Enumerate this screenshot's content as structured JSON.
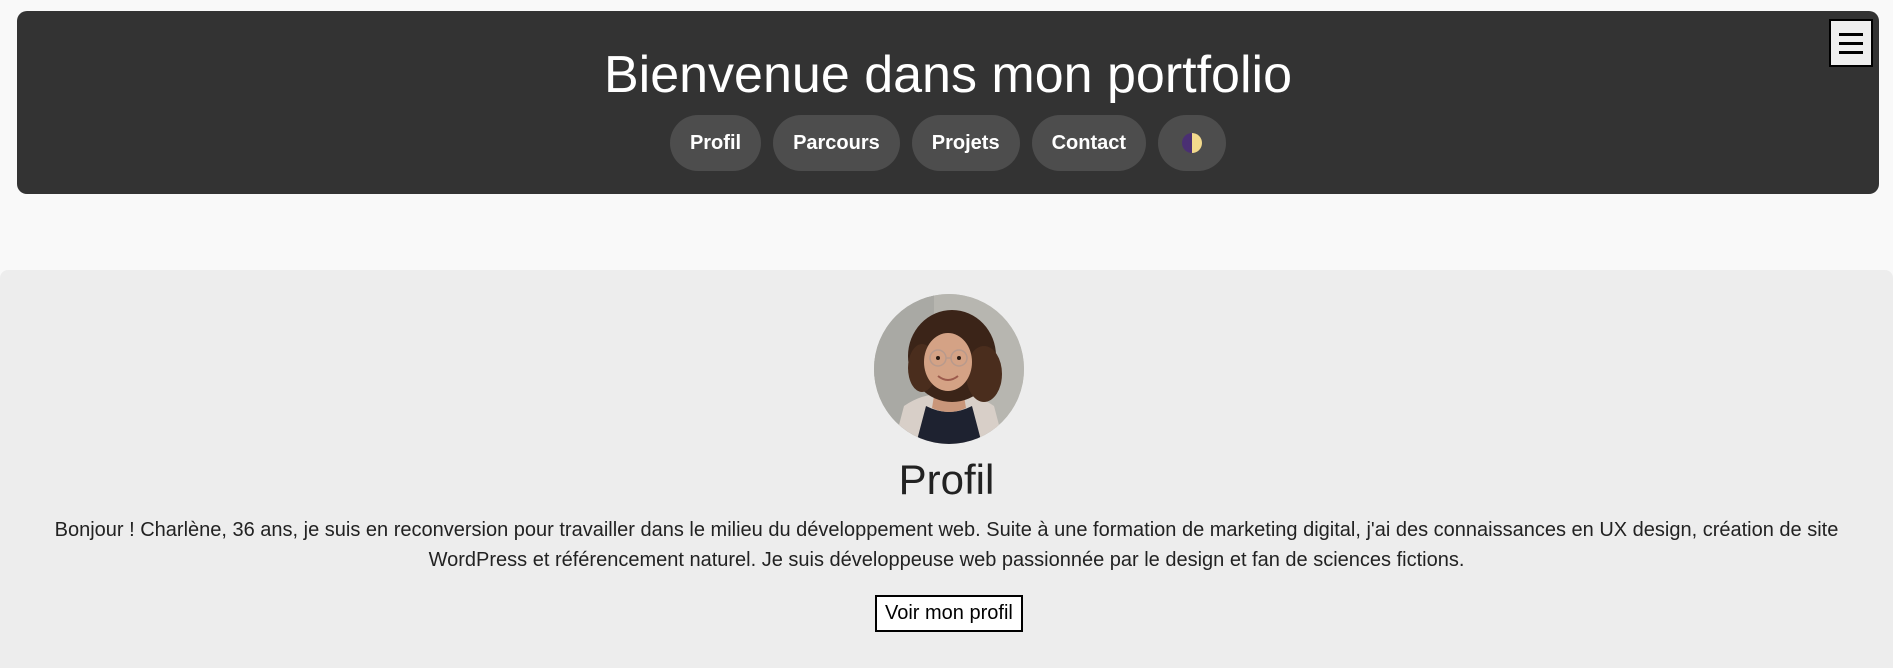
{
  "header": {
    "title": "Bienvenue dans mon portfolio",
    "menu_glyph": "☰",
    "nav": [
      {
        "label": "Profil"
      },
      {
        "label": "Parcours"
      },
      {
        "label": "Projets"
      },
      {
        "label": "Contact"
      }
    ],
    "theme_toggle_icon": "half-moon-theme-icon"
  },
  "profile": {
    "avatar_icon": "profile-photo",
    "heading": "Profil",
    "text": "Bonjour ! Charlène, 36 ans, je suis en reconversion pour travailler dans le milieu du développement web. Suite à une formation de marketing digital, j'ai des connaissances en UX design, création de site WordPress et référencement naturel. Je suis développeuse web passionnée par le design et fan de sciences fictions.",
    "button_label": "Voir mon profil"
  },
  "colors": {
    "header_bg": "#333333",
    "pill_bg": "#4d4d4d",
    "section_bg": "#ededed",
    "page_bg": "#f9f9f9"
  }
}
